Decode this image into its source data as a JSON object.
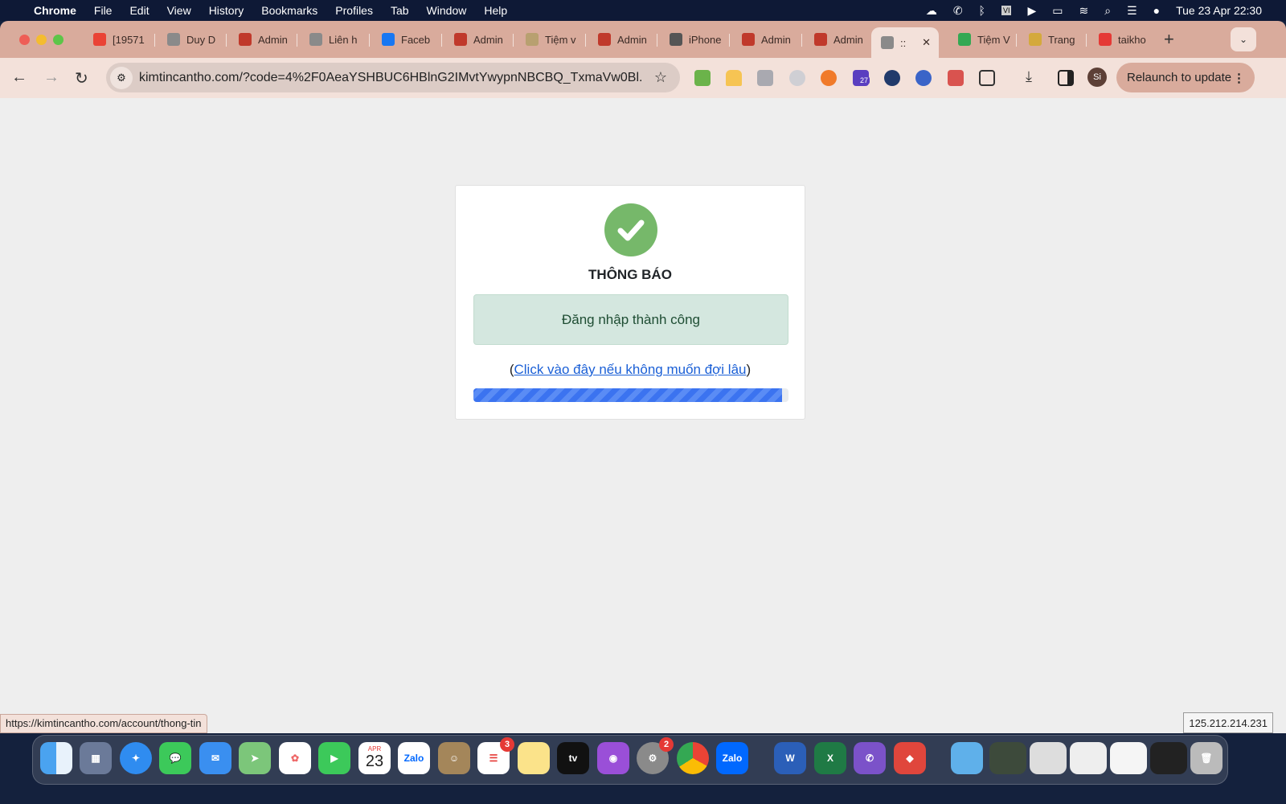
{
  "menubar": {
    "app": "Chrome",
    "items": [
      "File",
      "Edit",
      "View",
      "History",
      "Bookmarks",
      "Profiles",
      "Tab",
      "Window",
      "Help"
    ],
    "clock": "Tue 23 Apr  22:30"
  },
  "tabs": [
    {
      "label": "[19571",
      "icon": "gmail-icon",
      "color": "#ea4335"
    },
    {
      "label": "Duy D",
      "icon": "globe-icon",
      "color": "#8a8a8a"
    },
    {
      "label": "Admin",
      "icon": "nn-logo-icon",
      "color": "#c0392b"
    },
    {
      "label": "Liên h",
      "icon": "globe-icon",
      "color": "#8a8a8a"
    },
    {
      "label": "Faceb",
      "icon": "facebook-icon",
      "color": "#1877f2"
    },
    {
      "label": "Admin",
      "icon": "nn-logo-icon",
      "color": "#c0392b"
    },
    {
      "label": "Tiệm v",
      "icon": "crown-icon",
      "color": "#b8a070"
    },
    {
      "label": "Admin",
      "icon": "nn-logo-icon",
      "color": "#c0392b"
    },
    {
      "label": "iPhone",
      "icon": "iphone-icon",
      "color": "#555"
    },
    {
      "label": "Admin",
      "icon": "nn-logo-icon",
      "color": "#c0392b"
    },
    {
      "label": "Admin",
      "icon": "nn-logo-icon",
      "color": "#c0392b"
    },
    {
      "label": "::",
      "icon": "globe-icon",
      "color": "#8a8a8a",
      "active": true
    },
    {
      "label": "Tiệm V",
      "icon": "maps-icon",
      "color": "#34a853"
    },
    {
      "label": "Trang",
      "icon": "arrow-icon",
      "color": "#d4a93c"
    },
    {
      "label": "taikho",
      "icon": "j-icon",
      "color": "#e53935"
    }
  ],
  "toolbar": {
    "url": "kimtincantho.com/?code=4%2F0AeaYSHBUC6HBlnG2IMvtYwypnNBCBQ_TxmaVw0Bl...",
    "relaunch": "Relaunch to update",
    "profile": "Si",
    "ext_badge": "27"
  },
  "card": {
    "title": "THÔNG BÁO",
    "message": "Đăng nhập thành công",
    "link_open": "(",
    "link_text": "Click vào đây nếu không muốn đợi lâu",
    "link_close": ")",
    "progress_percent": 98,
    "success_color": "#76b86a"
  },
  "status_url": "https://kimtincantho.com/account/thong-tin",
  "ip": "125.212.214.231",
  "dock": {
    "calendar_month": "APR",
    "calendar_day": "23",
    "reminders_badge": "3",
    "settings_badge": "2",
    "zalo": "Zalo",
    "tv": "tv"
  }
}
